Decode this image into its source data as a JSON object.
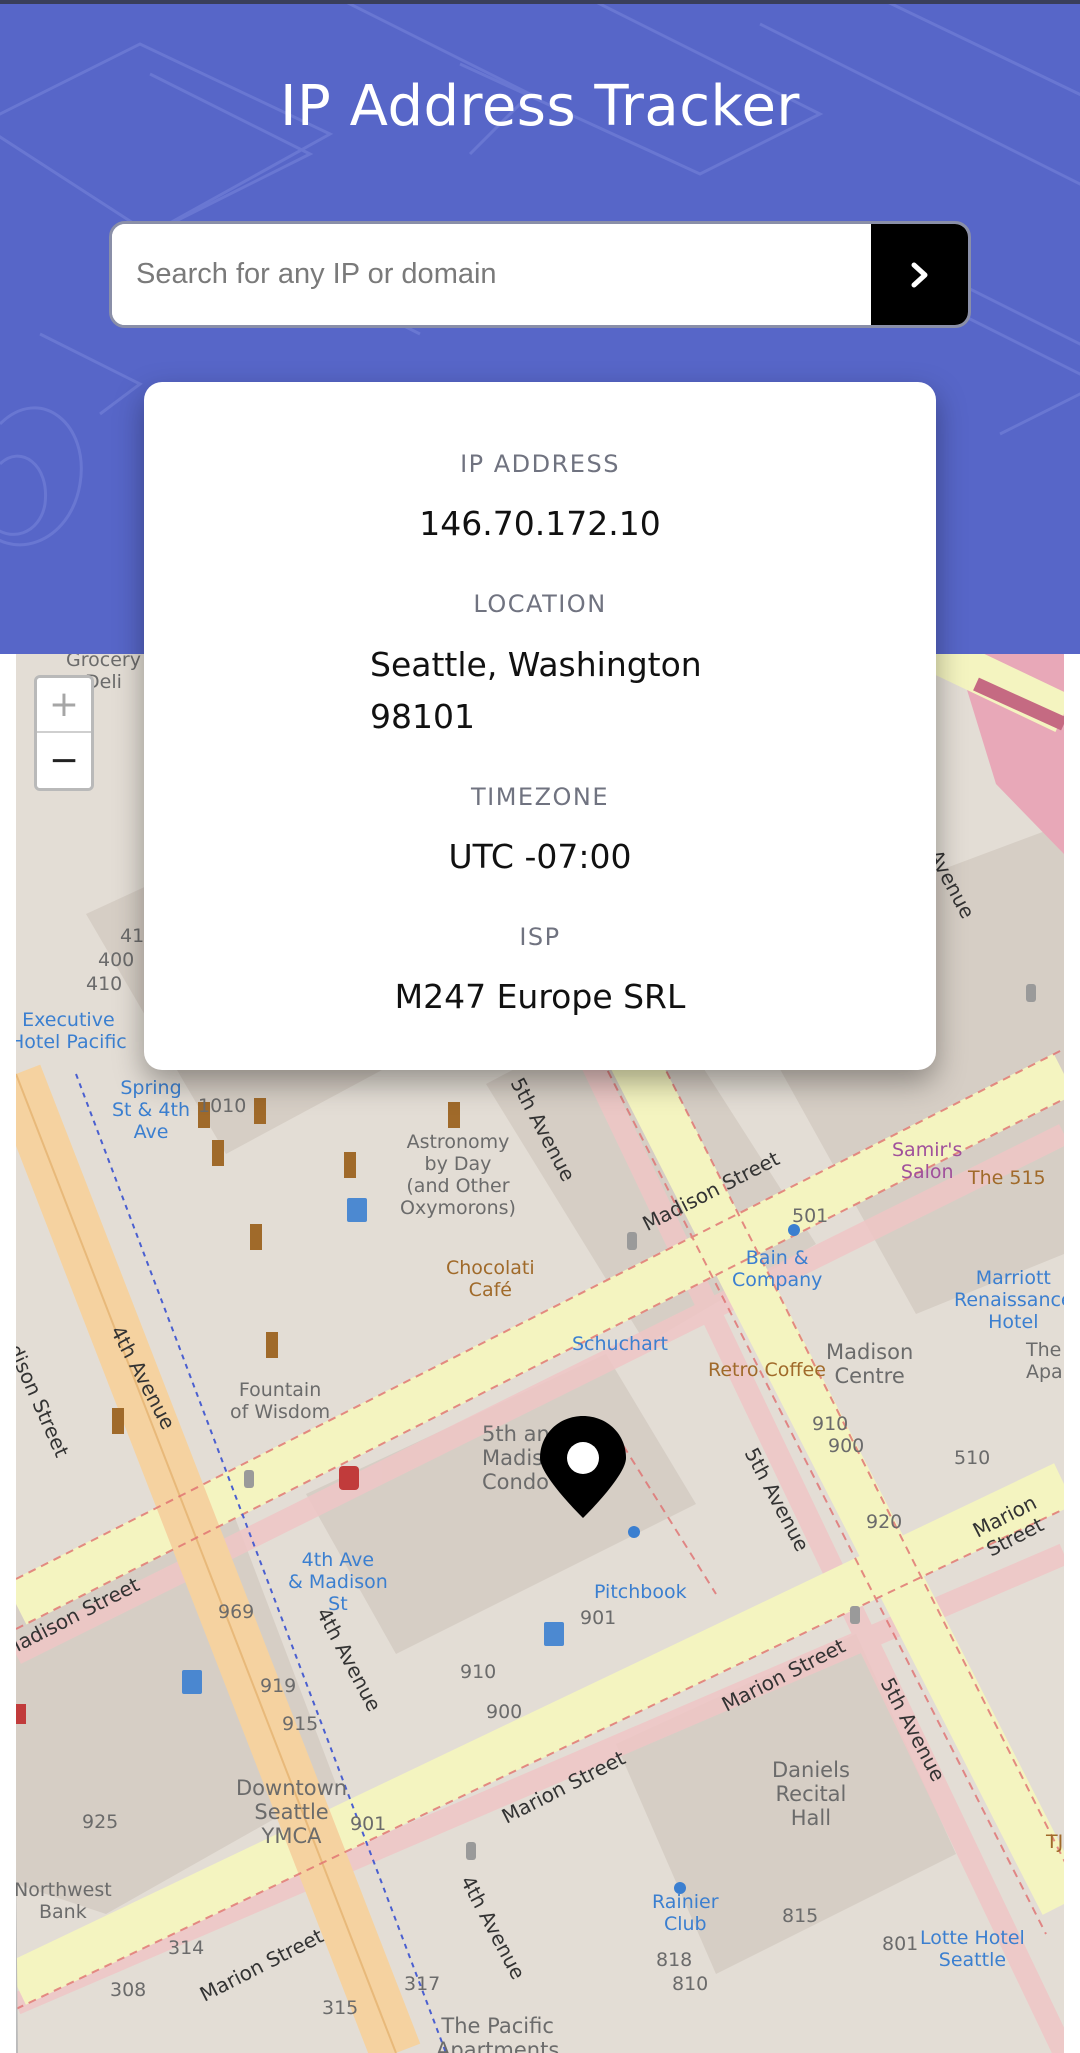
{
  "header": {
    "title": "IP Address Tracker"
  },
  "search": {
    "placeholder": "Search for any IP or domain",
    "value": "",
    "submit_icon": "chevron-right-icon"
  },
  "info_card": {
    "ip_address": {
      "label": "IP ADDRESS",
      "value": "146.70.172.10"
    },
    "location": {
      "label": "LOCATION",
      "line1": "Seattle, Washington",
      "line2": "98101"
    },
    "timezone": {
      "label": "TIMEZONE",
      "value": "UTC -07:00"
    },
    "isp": {
      "label": "ISP",
      "value": "M247 Europe SRL"
    }
  },
  "map": {
    "zoom_in": "+",
    "zoom_out": "−",
    "marker_icon": "location-pin-icon",
    "labels": {
      "grocery": "Grocery\nDeli",
      "executive_hotel": "Executive\nHotel Pacific",
      "spring_4th": "Spring\nSt & 4th\nAve",
      "astronomy": "Astronomy\nby Day\n(and Other\nOxymorons)",
      "chocolati": "Chocolati\nCafé",
      "fountain": "Fountain\nof Wisdom",
      "schuchart": "Schuchart",
      "bain": "Bain &\nCompany",
      "retro_coffee": "Retro Coffee",
      "madison_centre": "Madison\nCentre",
      "samirs": "Samir's\nSalon",
      "the515": "The 515",
      "marriott": "Marriott\nRenaissance\nHotel",
      "the_apar": "The\nApar",
      "fifth_madison": "5th an\nMadis\nCondo",
      "ave4_madison": "4th Ave\n& Madison\nSt",
      "pitchbook": "Pitchbook",
      "downtown_ymca": "Downtown\nSeattle\nYMCA",
      "northwest_bank": "Northwest\nBank",
      "daniels": "Daniels\nRecital\nHall",
      "rainier_club": "Rainier\nClub",
      "lotte": "Lotte Hotel\nSeattle",
      "pacific_apts": "The Pacific\nApartments",
      "tj": "TJ"
    },
    "streets": {
      "madison_street": "Madison Street",
      "marion_street": "Marion Street",
      "fourth_avenue": "4th Avenue",
      "fifth_avenue": "5th Avenue",
      "avenue": "Avenue"
    },
    "numbers": [
      "41",
      "400",
      "410",
      "1010",
      "501",
      "910",
      "900",
      "510",
      "920",
      "969",
      "919",
      "915",
      "925",
      "901",
      "910",
      "900",
      "901",
      "314",
      "308",
      "317",
      "315",
      "815",
      "801",
      "818",
      "810"
    ]
  }
}
